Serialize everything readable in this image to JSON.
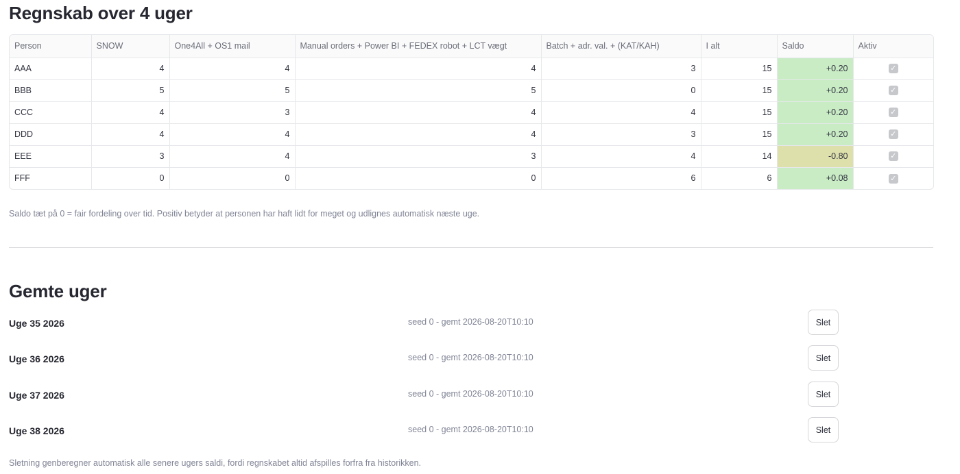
{
  "regnskab": {
    "title": "Regnskab over 4 uger",
    "headers": [
      "Person",
      "SNOW",
      "One4All + OS1 mail",
      "Manual orders + Power BI + FEDEX robot + LCT vægt",
      "Batch + adr. val. + (KAT/KAH)",
      "I alt",
      "Saldo",
      "Aktiv"
    ],
    "rows": [
      {
        "person": "AAA",
        "snow": "4",
        "one4all": "4",
        "manual": "4",
        "batch": "3",
        "ialt": "15",
        "saldo": "+0.20",
        "saldo_status": "pos",
        "aktiv": true
      },
      {
        "person": "BBB",
        "snow": "5",
        "one4all": "5",
        "manual": "5",
        "batch": "0",
        "ialt": "15",
        "saldo": "+0.20",
        "saldo_status": "pos",
        "aktiv": true
      },
      {
        "person": "CCC",
        "snow": "4",
        "one4all": "3",
        "manual": "4",
        "batch": "4",
        "ialt": "15",
        "saldo": "+0.20",
        "saldo_status": "pos",
        "aktiv": true
      },
      {
        "person": "DDD",
        "snow": "4",
        "one4all": "4",
        "manual": "4",
        "batch": "3",
        "ialt": "15",
        "saldo": "+0.20",
        "saldo_status": "pos",
        "aktiv": true
      },
      {
        "person": "EEE",
        "snow": "3",
        "one4all": "4",
        "manual": "3",
        "batch": "4",
        "ialt": "14",
        "saldo": "-0.80",
        "saldo_status": "neg",
        "aktiv": true
      },
      {
        "person": "FFF",
        "snow": "0",
        "one4all": "0",
        "manual": "0",
        "batch": "6",
        "ialt": "6",
        "saldo": "+0.08",
        "saldo_status": "pos",
        "aktiv": true
      }
    ],
    "caption": "Saldo tæt på 0 = fair fordeling over tid. Positiv betyder at personen har haft lidt for meget og udlignes automatisk næste uge."
  },
  "gemte_uger": {
    "title": "Gemte uger",
    "weeks": [
      {
        "name": "Uge 35 2026",
        "meta": "seed 0 - gemt 2026-08-20T10:10",
        "button": "Slet"
      },
      {
        "name": "Uge 36 2026",
        "meta": "seed 0 - gemt 2026-08-20T10:10",
        "button": "Slet"
      },
      {
        "name": "Uge 37 2026",
        "meta": "seed 0 - gemt 2026-08-20T10:10",
        "button": "Slet"
      },
      {
        "name": "Uge 38 2026",
        "meta": "seed 0 - gemt 2026-08-20T10:10",
        "button": "Slet"
      }
    ],
    "note": "Sletning genberegner automatisk alle senere ugers saldi, fordi regnskabet altid afspilles forfra fra historikken."
  },
  "colors": {
    "saldo_positive": "#c9ecc5",
    "saldo_negative": "#dee0ac"
  }
}
